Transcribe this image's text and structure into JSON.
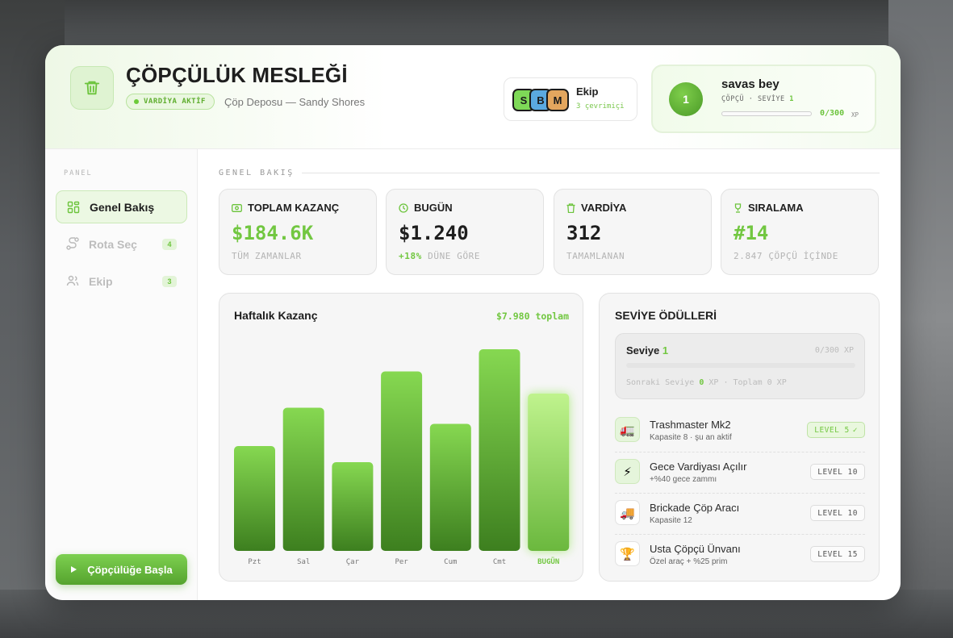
{
  "header": {
    "title": "ÇÖPÇÜLÜK MESLEĞİ",
    "shift_badge": "VARDİYA AKTİF",
    "location": "Çöp Deposu — Sandy Shores",
    "team": {
      "label": "Ekip",
      "online": "3 çevrimiçi",
      "members": [
        "S",
        "B",
        "M"
      ],
      "member_colors": [
        "#7ed957",
        "#5aa9e0",
        "#e3a65e"
      ]
    },
    "profile": {
      "level": "1",
      "name": "savas bey",
      "role_prefix": "ÇÖPÇÜ · SEVİYE",
      "role_level": "1",
      "xp": "0/300",
      "xp_unit": "XP",
      "xp_progress": 0
    }
  },
  "sidebar": {
    "label": "PANEL",
    "items": [
      {
        "label": "Genel Bakış",
        "count": "",
        "active": true
      },
      {
        "label": "Rota Seç",
        "count": "4",
        "active": false
      },
      {
        "label": "Ekip",
        "count": "3",
        "active": false
      }
    ],
    "start_button": "Çöpçülüğe Başla"
  },
  "overview": {
    "section_label": "GENEL BAKIŞ",
    "stats": [
      {
        "label": "TOPLAM KAZANÇ",
        "icon": "cash-icon",
        "value": "$184.6K",
        "sub_highlight": "",
        "sub": "TÜM ZAMANLAR"
      },
      {
        "label": "BUGÜN",
        "icon": "clock-icon",
        "value": "$1.240",
        "sub_highlight": "+18%",
        "sub": "DÜNE GÖRE"
      },
      {
        "label": "VARDİYA",
        "icon": "trash-icon",
        "value": "312",
        "sub_highlight": "",
        "sub": "TAMAMLANAN"
      },
      {
        "label": "SIRALAMA",
        "icon": "trophy-icon",
        "value": "#14",
        "sub_highlight": "",
        "sub": "2.847 ÇÖPÇÜ İÇİNDE"
      }
    ]
  },
  "weekly": {
    "title": "Haftalık Kazanç",
    "total": "$7.980 toplam"
  },
  "chart_data": {
    "type": "bar",
    "title": "Haftalık Kazanç",
    "categories": [
      "Pzt",
      "Sal",
      "Çar",
      "Per",
      "Cum",
      "Cmt",
      "BUGÜN"
    ],
    "values": [
      0.52,
      0.71,
      0.44,
      0.89,
      0.63,
      1.0,
      0.78
    ],
    "highlight_index": 6
  },
  "rewards": {
    "title": "SEVİYE ÖDÜLLERİ",
    "level_label": "Seviye",
    "level_value": "1",
    "level_xp": "0/300 XP",
    "next_prefix": "Sonraki Seviye",
    "next_value": "0",
    "next_suffix": "XP · Toplam 0 XP",
    "items": [
      {
        "title": "Trashmaster Mk2",
        "sub": "Kapasite 8 · şu an aktif",
        "badge": "LEVEL 5",
        "done": true,
        "icon": "truck-icon",
        "glyph": "🚛"
      },
      {
        "title": "Gece Vardiyası Açılır",
        "sub": "+%40 gece zammı",
        "badge": "LEVEL 10",
        "done": false,
        "icon": "bolt-icon",
        "glyph": "⚡"
      },
      {
        "title": "Brickade Çöp Aracı",
        "sub": "Kapasite 12",
        "badge": "LEVEL 10",
        "done": false,
        "icon": "dump-truck-icon",
        "glyph": "🚚"
      },
      {
        "title": "Usta Çöpçü Ünvanı",
        "sub": "Özel araç + %25 prim",
        "badge": "LEVEL 15",
        "done": false,
        "icon": "trophy-icon",
        "glyph": "🏆"
      }
    ]
  },
  "colors": {
    "accent": "#72c741",
    "accent_dark": "#4a9a27"
  }
}
